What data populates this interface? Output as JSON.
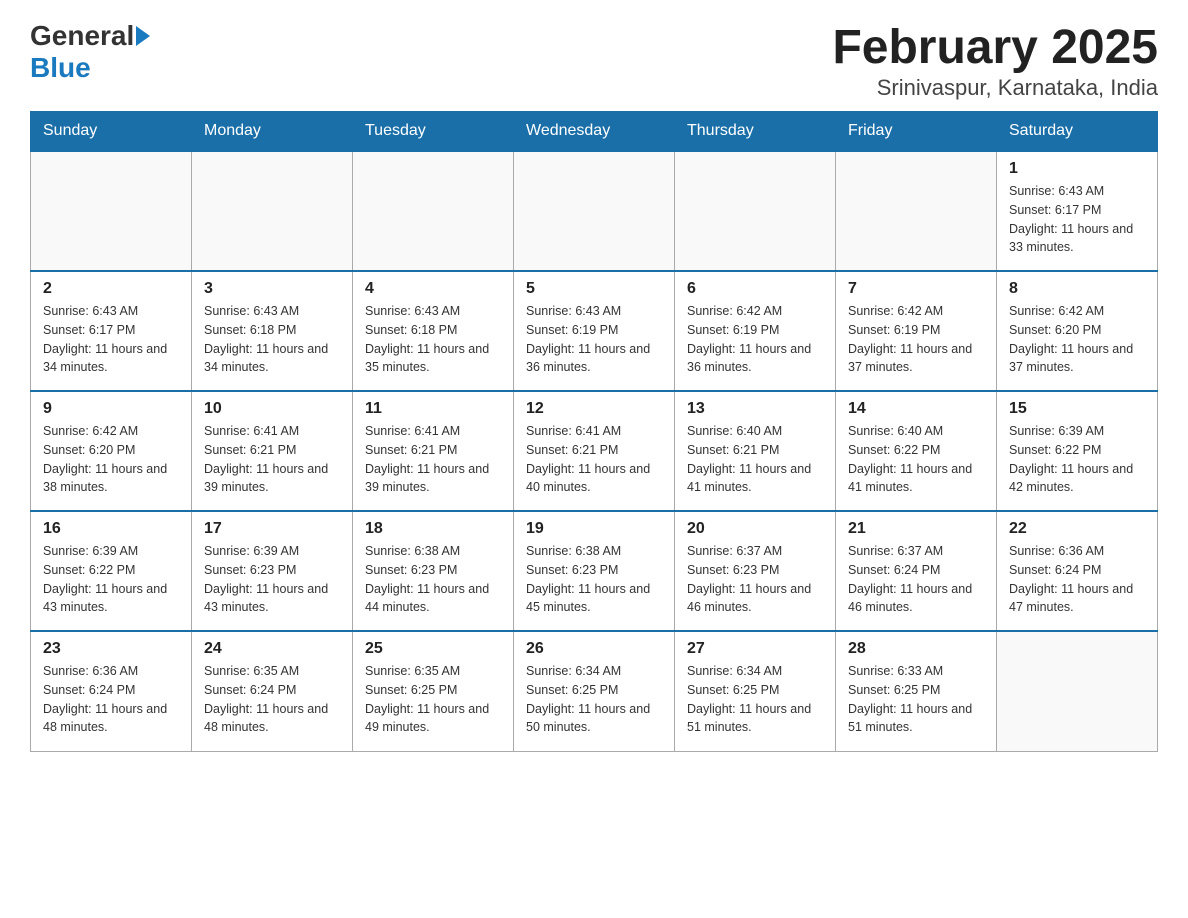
{
  "header": {
    "logo_general": "General",
    "logo_blue": "Blue",
    "month_title": "February 2025",
    "location": "Srinivaspur, Karnataka, India"
  },
  "weekdays": [
    "Sunday",
    "Monday",
    "Tuesday",
    "Wednesday",
    "Thursday",
    "Friday",
    "Saturday"
  ],
  "weeks": [
    [
      {
        "day": "",
        "sunrise": "",
        "sunset": "",
        "daylight": ""
      },
      {
        "day": "",
        "sunrise": "",
        "sunset": "",
        "daylight": ""
      },
      {
        "day": "",
        "sunrise": "",
        "sunset": "",
        "daylight": ""
      },
      {
        "day": "",
        "sunrise": "",
        "sunset": "",
        "daylight": ""
      },
      {
        "day": "",
        "sunrise": "",
        "sunset": "",
        "daylight": ""
      },
      {
        "day": "",
        "sunrise": "",
        "sunset": "",
        "daylight": ""
      },
      {
        "day": "1",
        "sunrise": "Sunrise: 6:43 AM",
        "sunset": "Sunset: 6:17 PM",
        "daylight": "Daylight: 11 hours and 33 minutes."
      }
    ],
    [
      {
        "day": "2",
        "sunrise": "Sunrise: 6:43 AM",
        "sunset": "Sunset: 6:17 PM",
        "daylight": "Daylight: 11 hours and 34 minutes."
      },
      {
        "day": "3",
        "sunrise": "Sunrise: 6:43 AM",
        "sunset": "Sunset: 6:18 PM",
        "daylight": "Daylight: 11 hours and 34 minutes."
      },
      {
        "day": "4",
        "sunrise": "Sunrise: 6:43 AM",
        "sunset": "Sunset: 6:18 PM",
        "daylight": "Daylight: 11 hours and 35 minutes."
      },
      {
        "day": "5",
        "sunrise": "Sunrise: 6:43 AM",
        "sunset": "Sunset: 6:19 PM",
        "daylight": "Daylight: 11 hours and 36 minutes."
      },
      {
        "day": "6",
        "sunrise": "Sunrise: 6:42 AM",
        "sunset": "Sunset: 6:19 PM",
        "daylight": "Daylight: 11 hours and 36 minutes."
      },
      {
        "day": "7",
        "sunrise": "Sunrise: 6:42 AM",
        "sunset": "Sunset: 6:19 PM",
        "daylight": "Daylight: 11 hours and 37 minutes."
      },
      {
        "day": "8",
        "sunrise": "Sunrise: 6:42 AM",
        "sunset": "Sunset: 6:20 PM",
        "daylight": "Daylight: 11 hours and 37 minutes."
      }
    ],
    [
      {
        "day": "9",
        "sunrise": "Sunrise: 6:42 AM",
        "sunset": "Sunset: 6:20 PM",
        "daylight": "Daylight: 11 hours and 38 minutes."
      },
      {
        "day": "10",
        "sunrise": "Sunrise: 6:41 AM",
        "sunset": "Sunset: 6:21 PM",
        "daylight": "Daylight: 11 hours and 39 minutes."
      },
      {
        "day": "11",
        "sunrise": "Sunrise: 6:41 AM",
        "sunset": "Sunset: 6:21 PM",
        "daylight": "Daylight: 11 hours and 39 minutes."
      },
      {
        "day": "12",
        "sunrise": "Sunrise: 6:41 AM",
        "sunset": "Sunset: 6:21 PM",
        "daylight": "Daylight: 11 hours and 40 minutes."
      },
      {
        "day": "13",
        "sunrise": "Sunrise: 6:40 AM",
        "sunset": "Sunset: 6:21 PM",
        "daylight": "Daylight: 11 hours and 41 minutes."
      },
      {
        "day": "14",
        "sunrise": "Sunrise: 6:40 AM",
        "sunset": "Sunset: 6:22 PM",
        "daylight": "Daylight: 11 hours and 41 minutes."
      },
      {
        "day": "15",
        "sunrise": "Sunrise: 6:39 AM",
        "sunset": "Sunset: 6:22 PM",
        "daylight": "Daylight: 11 hours and 42 minutes."
      }
    ],
    [
      {
        "day": "16",
        "sunrise": "Sunrise: 6:39 AM",
        "sunset": "Sunset: 6:22 PM",
        "daylight": "Daylight: 11 hours and 43 minutes."
      },
      {
        "day": "17",
        "sunrise": "Sunrise: 6:39 AM",
        "sunset": "Sunset: 6:23 PM",
        "daylight": "Daylight: 11 hours and 43 minutes."
      },
      {
        "day": "18",
        "sunrise": "Sunrise: 6:38 AM",
        "sunset": "Sunset: 6:23 PM",
        "daylight": "Daylight: 11 hours and 44 minutes."
      },
      {
        "day": "19",
        "sunrise": "Sunrise: 6:38 AM",
        "sunset": "Sunset: 6:23 PM",
        "daylight": "Daylight: 11 hours and 45 minutes."
      },
      {
        "day": "20",
        "sunrise": "Sunrise: 6:37 AM",
        "sunset": "Sunset: 6:23 PM",
        "daylight": "Daylight: 11 hours and 46 minutes."
      },
      {
        "day": "21",
        "sunrise": "Sunrise: 6:37 AM",
        "sunset": "Sunset: 6:24 PM",
        "daylight": "Daylight: 11 hours and 46 minutes."
      },
      {
        "day": "22",
        "sunrise": "Sunrise: 6:36 AM",
        "sunset": "Sunset: 6:24 PM",
        "daylight": "Daylight: 11 hours and 47 minutes."
      }
    ],
    [
      {
        "day": "23",
        "sunrise": "Sunrise: 6:36 AM",
        "sunset": "Sunset: 6:24 PM",
        "daylight": "Daylight: 11 hours and 48 minutes."
      },
      {
        "day": "24",
        "sunrise": "Sunrise: 6:35 AM",
        "sunset": "Sunset: 6:24 PM",
        "daylight": "Daylight: 11 hours and 48 minutes."
      },
      {
        "day": "25",
        "sunrise": "Sunrise: 6:35 AM",
        "sunset": "Sunset: 6:25 PM",
        "daylight": "Daylight: 11 hours and 49 minutes."
      },
      {
        "day": "26",
        "sunrise": "Sunrise: 6:34 AM",
        "sunset": "Sunset: 6:25 PM",
        "daylight": "Daylight: 11 hours and 50 minutes."
      },
      {
        "day": "27",
        "sunrise": "Sunrise: 6:34 AM",
        "sunset": "Sunset: 6:25 PM",
        "daylight": "Daylight: 11 hours and 51 minutes."
      },
      {
        "day": "28",
        "sunrise": "Sunrise: 6:33 AM",
        "sunset": "Sunset: 6:25 PM",
        "daylight": "Daylight: 11 hours and 51 minutes."
      },
      {
        "day": "",
        "sunrise": "",
        "sunset": "",
        "daylight": ""
      }
    ]
  ]
}
